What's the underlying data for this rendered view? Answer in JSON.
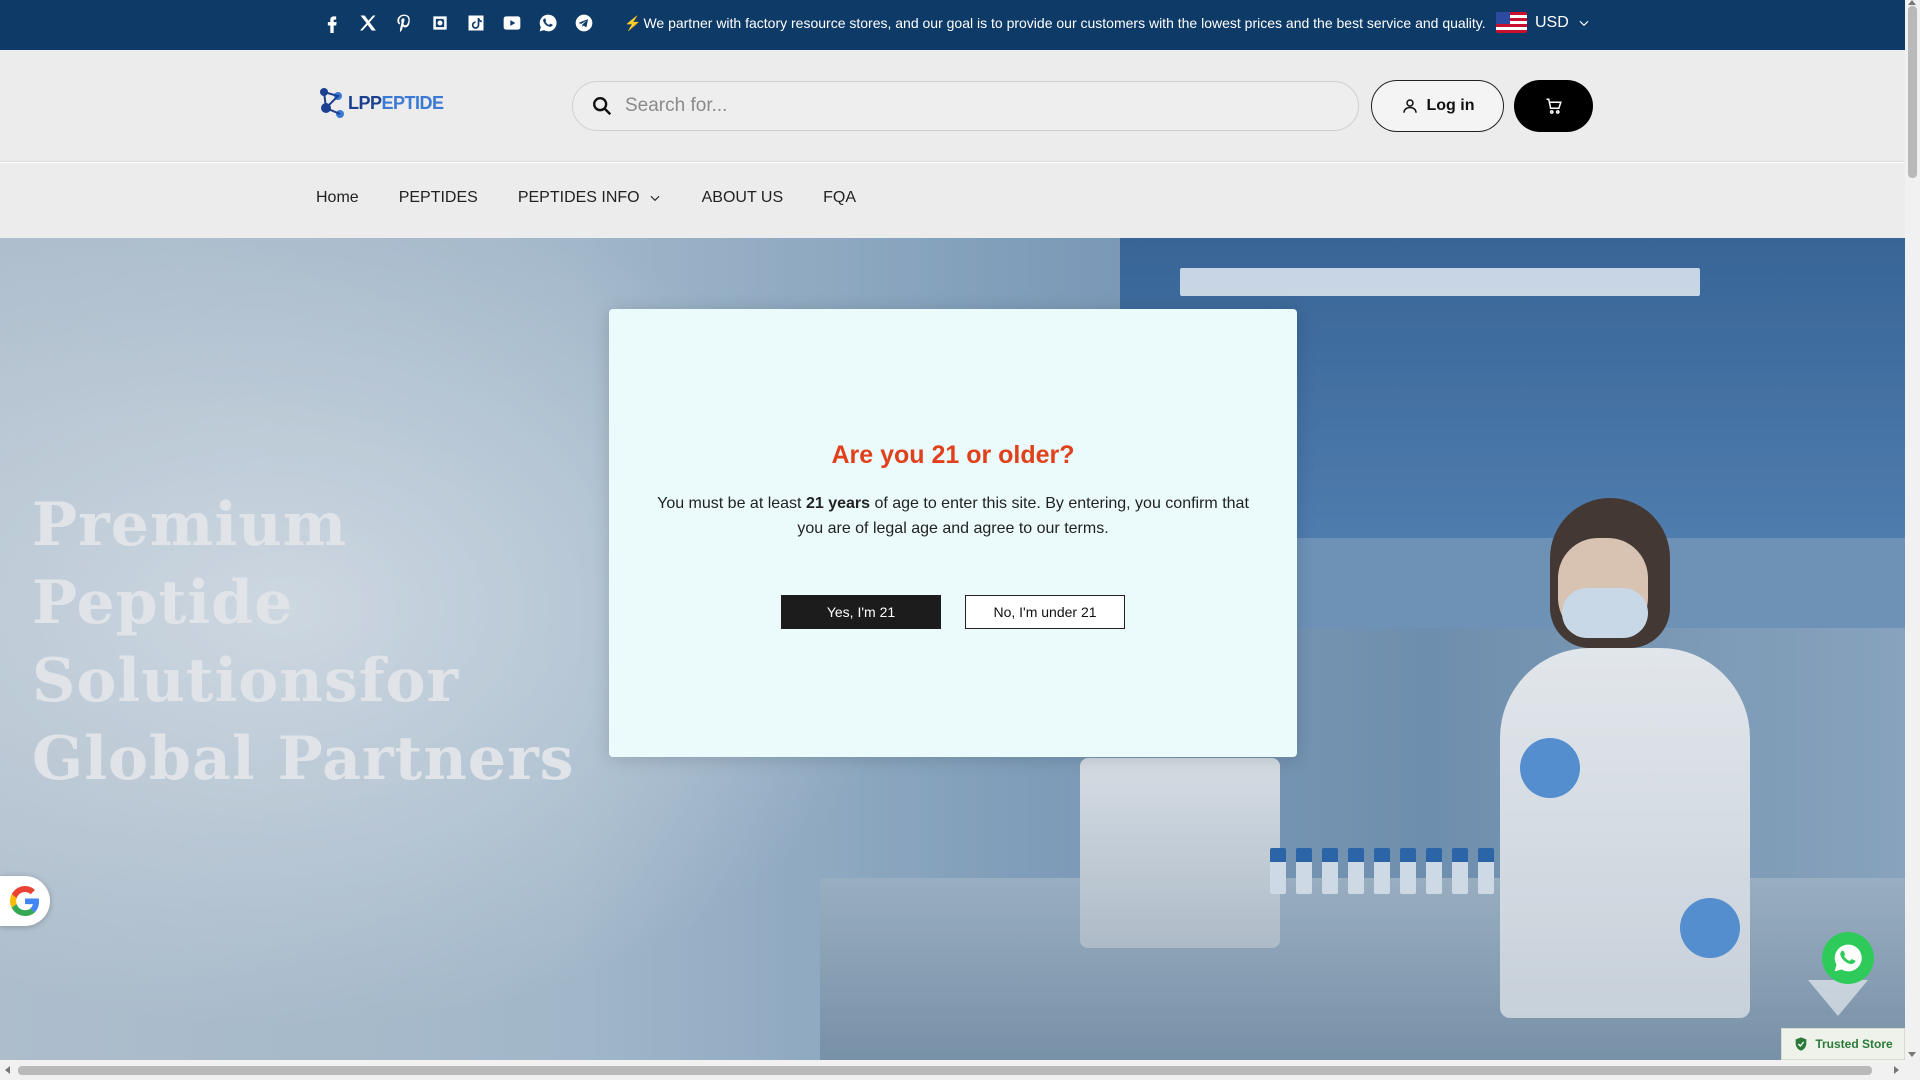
{
  "topbar": {
    "social_icons": [
      "facebook-icon",
      "x-icon",
      "pinterest-icon",
      "instagram-icon",
      "tiktok-icon",
      "youtube-icon",
      "whatsapp-icon",
      "telegram-icon"
    ],
    "announcement": "We partner with factory resource stores, and our goal is to provide our customers with the lowest prices and the best service and quality.",
    "announcement_prefix": "⚡",
    "currency": "USD"
  },
  "header": {
    "logo_part1": "LPP",
    "logo_part2": "EPTIDE",
    "search_placeholder": "Search for...",
    "login_label": "Log in"
  },
  "nav": {
    "items": [
      {
        "label": "Home"
      },
      {
        "label": "PEPTIDES"
      },
      {
        "label": "PEPTIDES INFO"
      },
      {
        "label": "ABOUT US"
      },
      {
        "label": "FQA"
      }
    ]
  },
  "hero": {
    "title_lines": [
      "Premium",
      "Peptide",
      "Solutionsfor",
      "Global Partners"
    ]
  },
  "age_modal": {
    "title": "Are you 21 or older?",
    "text_before": "You must be at least ",
    "text_bold": "21 years",
    "text_after": " of age to enter this site. By entering, you confirm that you are of legal age and agree to our terms.",
    "yes_label": "Yes, I'm 21",
    "no_label": "No, I'm under 21"
  },
  "widgets": {
    "trusted_label": "Trusted Store"
  },
  "colors": {
    "topbar_bg": "#0d3a66",
    "modal_bg": "#ebfbfb",
    "modal_title": "#e0401c",
    "whatsapp": "#2ecb5b"
  }
}
